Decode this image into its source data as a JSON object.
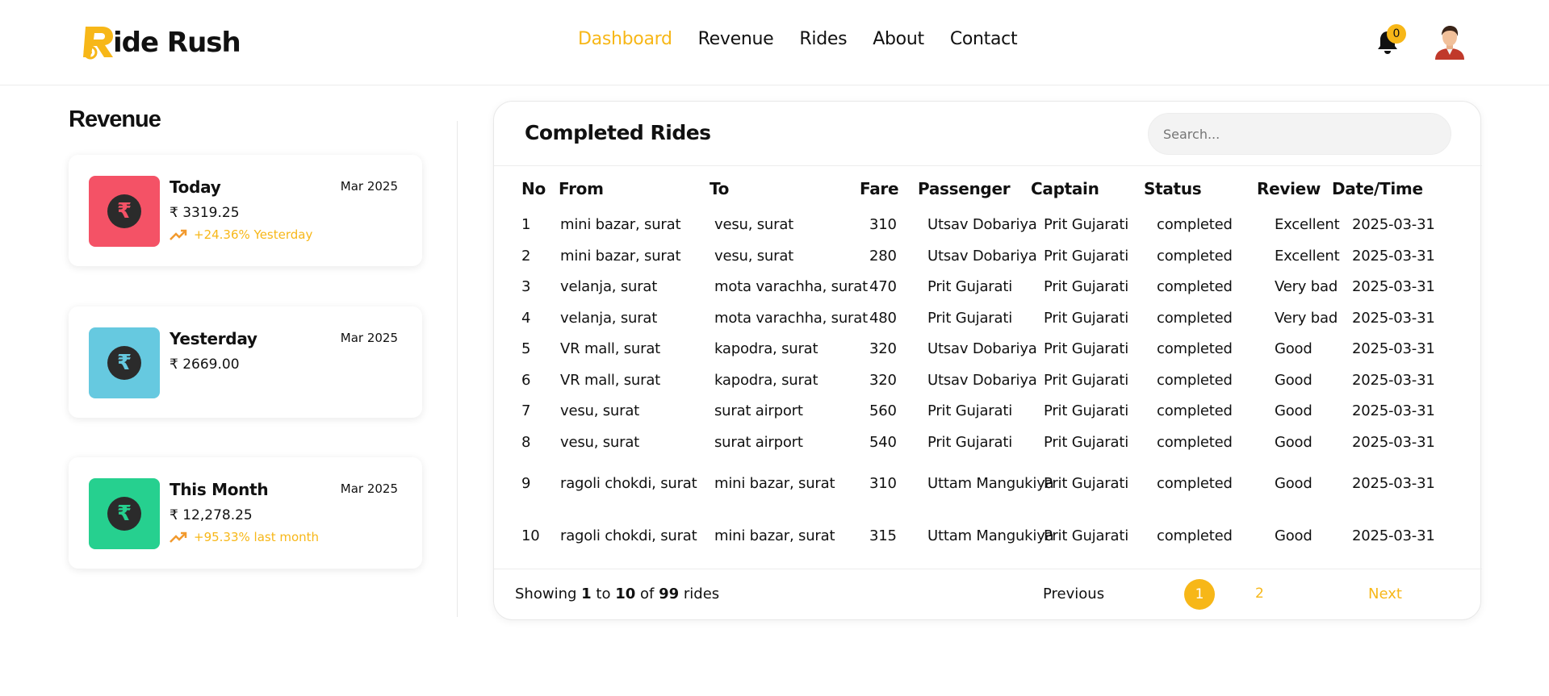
{
  "brand": {
    "logo_letter": "R",
    "name_rest": "ide Rush",
    "accent": "#f7b718"
  },
  "nav": {
    "items": [
      {
        "label": "Dashboard",
        "active": true
      },
      {
        "label": "Revenue",
        "active": false
      },
      {
        "label": "Rides",
        "active": false
      },
      {
        "label": "About",
        "active": false
      },
      {
        "label": "Contact",
        "active": false
      }
    ]
  },
  "notifications": {
    "icon": "bell-icon",
    "count": "0"
  },
  "user": {
    "icon": "avatar"
  },
  "revenue": {
    "title": "Revenue",
    "cards": [
      {
        "title": "Today",
        "date": "Mar 2025",
        "value": "₹ 3319.25",
        "trend": "+24.36% Yesterday",
        "color": "#f45266",
        "icon_color": "#f45266"
      },
      {
        "title": "Yesterday",
        "date": "Mar 2025",
        "value": "₹ 2669.00",
        "trend": "",
        "color": "#66c9e0",
        "icon_color": "#66c9e0"
      },
      {
        "title": "This Month",
        "date": "Mar 2025",
        "value": "₹ 12,278.25",
        "trend": "+95.33% last month",
        "color": "#26d08f",
        "icon_color": "#26d08f"
      }
    ]
  },
  "rides": {
    "title": "Completed Rides",
    "search_placeholder": "Search...",
    "columns": [
      "No",
      "From",
      "To",
      "Fare",
      "Passenger",
      "Captain",
      "Status",
      "Review",
      "Date/Time"
    ],
    "rows": [
      [
        "1",
        "mini bazar, surat",
        "vesu, surat",
        "310",
        "Utsav Dobariya",
        "Prit Gujarati",
        "completed",
        "Excellent",
        "2025-03-31"
      ],
      [
        "2",
        "mini bazar, surat",
        "vesu, surat",
        "280",
        "Utsav Dobariya",
        "Prit Gujarati",
        "completed",
        "Excellent",
        "2025-03-31"
      ],
      [
        "3",
        "velanja, surat",
        "mota varachha, surat",
        "470",
        "Prit Gujarati",
        "Prit Gujarati",
        "completed",
        "Very bad",
        "2025-03-31"
      ],
      [
        "4",
        "velanja, surat",
        "mota varachha, surat",
        "480",
        "Prit Gujarati",
        "Prit Gujarati",
        "completed",
        "Very bad",
        "2025-03-31"
      ],
      [
        "5",
        "VR mall, surat",
        "kapodra, surat",
        "320",
        "Utsav Dobariya",
        "Prit Gujarati",
        "completed",
        "Good",
        "2025-03-31"
      ],
      [
        "6",
        "VR mall, surat",
        "kapodra, surat",
        "320",
        "Utsav Dobariya",
        "Prit Gujarati",
        "completed",
        "Good",
        "2025-03-31"
      ],
      [
        "7",
        "vesu, surat",
        "surat airport",
        "560",
        "Prit Gujarati",
        "Prit Gujarati",
        "completed",
        "Good",
        "2025-03-31"
      ],
      [
        "8",
        "vesu, surat",
        "surat airport",
        "540",
        "Prit Gujarati",
        "Prit Gujarati",
        "completed",
        "Good",
        "2025-03-31"
      ],
      [
        "9",
        "ragoli chokdi, surat",
        "mini bazar, surat",
        "310",
        "Uttam Mangukiya",
        "Prit Gujarati",
        "completed",
        "Good",
        "2025-03-31"
      ],
      [
        "10",
        "ragoli chokdi, surat",
        "mini bazar, surat",
        "315",
        "Uttam Mangukiya",
        "Prit Gujarati",
        "completed",
        "Good",
        "2025-03-31"
      ]
    ],
    "footer": {
      "showing": "Showing",
      "from": "1",
      "to_word": "to",
      "to": "10",
      "of_word": "of",
      "total": "99",
      "unit": "rides"
    },
    "pagination": {
      "previous": "Previous",
      "pages": [
        "1",
        "2"
      ],
      "next": "Next"
    }
  }
}
